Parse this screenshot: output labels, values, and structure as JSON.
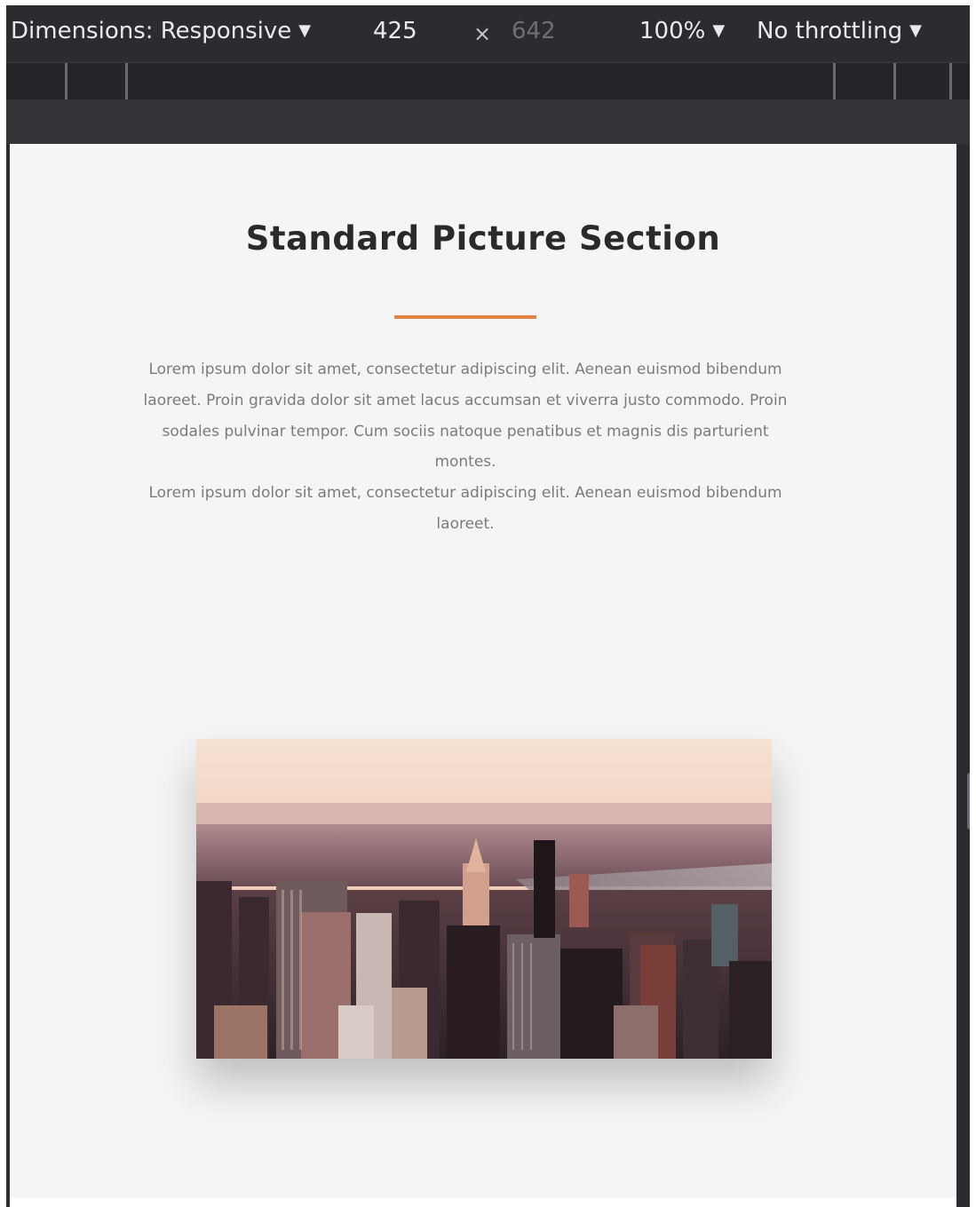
{
  "devtools": {
    "dimensions_label": "Dimensions: Responsive",
    "width": "425",
    "times": "×",
    "height_placeholder": "642",
    "zoom": "100%",
    "throttling": "No throttling",
    "caret": "▼"
  },
  "page": {
    "title": "Standard Picture Section",
    "paragraph_1": "Lorem ipsum dolor sit amet, consectetur adipiscing elit. Aenean euismod bibendum laoreet. Proin gravida dolor sit amet lacus accumsan et viverra justo commodo. Proin sodales pulvinar tempor. Cum sociis natoque penatibus et magnis dis parturient montes.",
    "paragraph_2": "Lorem ipsum dolor sit amet, consectetur adipiscing elit. Aenean euismod bibendum laoreet."
  },
  "colors": {
    "accent": "#e38444",
    "toolbar": "#2b2c2f",
    "page_background": "#f5f5f5",
    "dot_red": "#e0443e",
    "dot_yellow": "#dea123",
    "dot_green": "#1aab29"
  },
  "icons": {
    "dropdown": "caret-down-icon",
    "swap": "times-icon",
    "resize": "resize-handle-icon"
  }
}
